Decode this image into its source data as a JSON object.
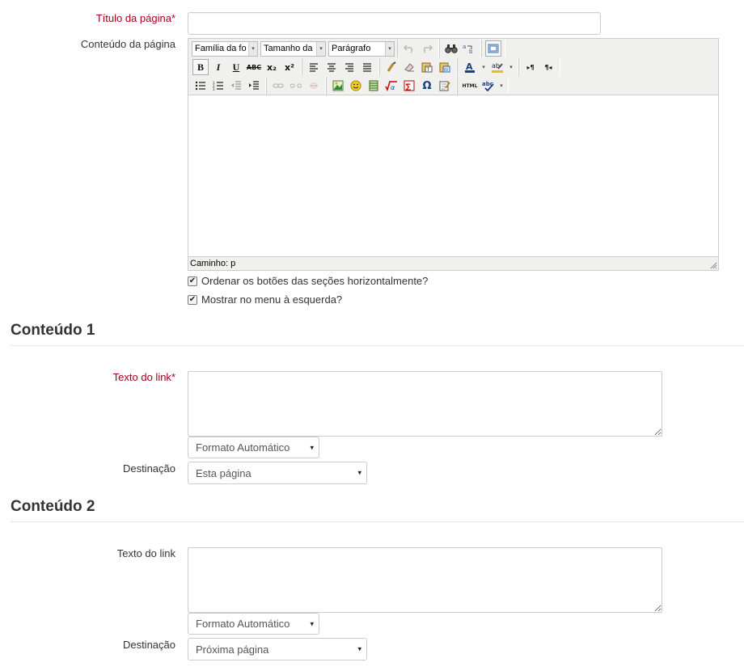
{
  "page_form": {
    "title_label": "Título da página",
    "title_required": "*",
    "title_value": "",
    "content_label": "Conteúdo da página",
    "editor": {
      "font_family": "Família da fo",
      "font_size": "Tamanho da",
      "format": "Parágrafo",
      "path": "Caminho: p"
    },
    "checkbox_horizontal": "Ordenar os botões das seções horizontalmente?",
    "checkbox_horizontal_checked": true,
    "checkbox_menu": "Mostrar no menu à esquerda?",
    "checkbox_menu_checked": true
  },
  "sections": [
    {
      "heading": "Conteúdo 1",
      "link_text_label": "Texto do link",
      "link_required": "*",
      "link_text_value": "",
      "format_value": "Formato Automático",
      "destination_label": "Destinação",
      "destination_value": "Esta página"
    },
    {
      "heading": "Conteúdo 2",
      "link_text_label": "Texto do link",
      "link_text_value": "",
      "format_value": "Formato Automático",
      "destination_label": "Destinação",
      "destination_value": "Próxima página"
    }
  ],
  "icons": {
    "bold": "B",
    "italic": "I",
    "underline": "U",
    "strikethrough": "ABC",
    "subscript": "x₂",
    "superscript": "x²",
    "omega": "Ω",
    "html": "HTML",
    "ltr": "▸¶",
    "rtl": "¶◂",
    "dropdown_arrow": "▾",
    "checkmark": "✔"
  },
  "colors": {
    "required": "#a4001a",
    "text": "#333333"
  }
}
